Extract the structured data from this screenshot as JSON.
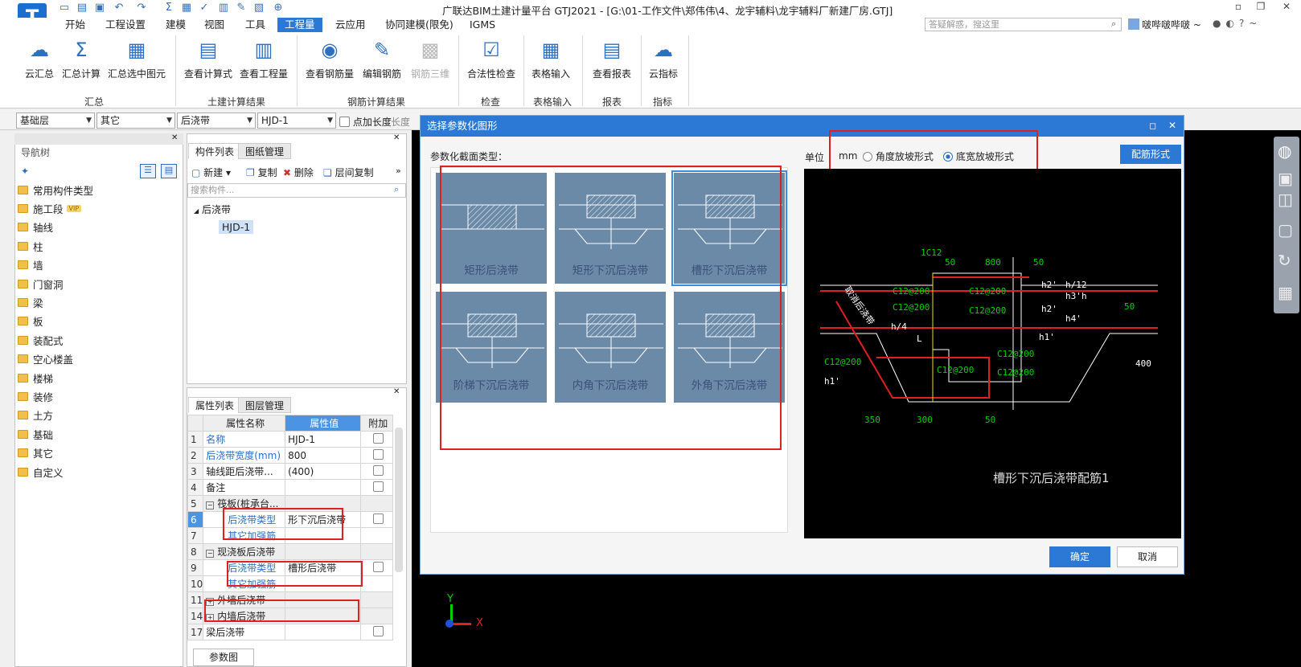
{
  "app": {
    "logo": "T",
    "title": "广联达BIM土建计量平台 GTJ2021 - [G:\\01-工作文件\\郑伟伟\\4、龙宇辅料\\龙宇辅料厂新建厂房.GTJ]",
    "user": "啵哔啵哔啵 ~",
    "search_placeholder": "答疑解惑，搜这里"
  },
  "menu": [
    "开始",
    "工程设置",
    "建模",
    "视图",
    "工具",
    "工程量",
    "云应用",
    "协同建模(限免)",
    "IGMS"
  ],
  "ribbon": {
    "buttons": [
      "云汇总",
      "汇总计算",
      "汇总选中图元",
      "查看计算式",
      "查看工程量",
      "查看钢筋量",
      "编辑钢筋",
      "钢筋三维",
      "合法性检查",
      "表格输入",
      "查看报表",
      "云指标"
    ],
    "groups": [
      "汇总",
      "土建计算结果",
      "钢筋计算结果",
      "检查",
      "表格输入",
      "报表",
      "指标"
    ]
  },
  "toolbar": {
    "floor": "基础层",
    "cat": "其它",
    "type": "后浇带",
    "item": "HJD-1",
    "checkbox": "点加长度",
    "length": "长度"
  },
  "nav": {
    "title": "导航树",
    "items": [
      "常用构件类型",
      "施工段",
      "轴线",
      "柱",
      "墙",
      "门窗洞",
      "梁",
      "板",
      "装配式",
      "空心楼盖",
      "楼梯",
      "装修",
      "土方",
      "基础",
      "其它",
      "自定义"
    ],
    "vip": "VIP"
  },
  "comp": {
    "tabs": [
      "构件列表",
      "图纸管理"
    ],
    "new": "新建",
    "copy": "复制",
    "del": "删除",
    "floorcopy": "层间复制",
    "search": "搜索构件...",
    "group": "后浇带",
    "selected": "HJD-1"
  },
  "props": {
    "tabs": [
      "属性列表",
      "图层管理"
    ],
    "headers": [
      "属性名称",
      "属性值",
      "附加"
    ],
    "rows": [
      {
        "n": "1",
        "name": "名称",
        "val": "HJD-1"
      },
      {
        "n": "2",
        "name": "后浇带宽度(mm)",
        "val": "800"
      },
      {
        "n": "3",
        "name": "轴线距后浇带...",
        "val": "(400)"
      },
      {
        "n": "4",
        "name": "备注",
        "val": ""
      },
      {
        "n": "5",
        "name": "筏板(桩承台...",
        "val": ""
      },
      {
        "n": "6",
        "name": "后浇带类型",
        "val": "形下沉后浇带"
      },
      {
        "n": "7",
        "name": "其它加强筋",
        "val": ""
      },
      {
        "n": "8",
        "name": "现浇板后浇带",
        "val": ""
      },
      {
        "n": "9",
        "name": "后浇带类型",
        "val": "槽形后浇带"
      },
      {
        "n": "10",
        "name": "其它加强筋",
        "val": ""
      },
      {
        "n": "11",
        "name": "外墙后浇带",
        "val": ""
      },
      {
        "n": "14",
        "name": "内墙后浇带",
        "val": ""
      },
      {
        "n": "17",
        "name": "梁后浇带",
        "val": ""
      }
    ],
    "button": "参数图"
  },
  "dialog": {
    "title": "选择参数化图形",
    "section": "参数化截面类型：",
    "unit_label": "单位",
    "unit": "mm",
    "radio1": "角度放坡形式",
    "radio2": "底宽放坡形式",
    "rebar_btn": "配筋形式",
    "shapes": [
      "矩形后浇带",
      "矩形下沉后浇带",
      "槽形下沉后浇带",
      "阶梯下沉后浇带",
      "内角下沉后浇带",
      "外角下沉后浇带"
    ],
    "ok": "确定",
    "cancel": "取消"
  },
  "cad": {
    "title": "槽形下沉后浇带配筋1",
    "labels": [
      "1C12",
      "50",
      "800",
      "50",
      "C12@200",
      "C12@200",
      "C12@200",
      "C12@200",
      "C12@200",
      "C12@200",
      "C12@200",
      "C12@200",
      "h1'",
      "h2'",
      "h3'",
      "h2'",
      "h4'",
      "h1'",
      "h/4",
      "h/12",
      "h",
      "50",
      "L",
      "400",
      "350",
      "300",
      "50",
      "取消后浇带"
    ]
  },
  "axis": {
    "x": "X",
    "y": "Y"
  },
  "colors": {
    "accent": "#2b79d4",
    "red": "#e02020",
    "green": "#00d000"
  }
}
